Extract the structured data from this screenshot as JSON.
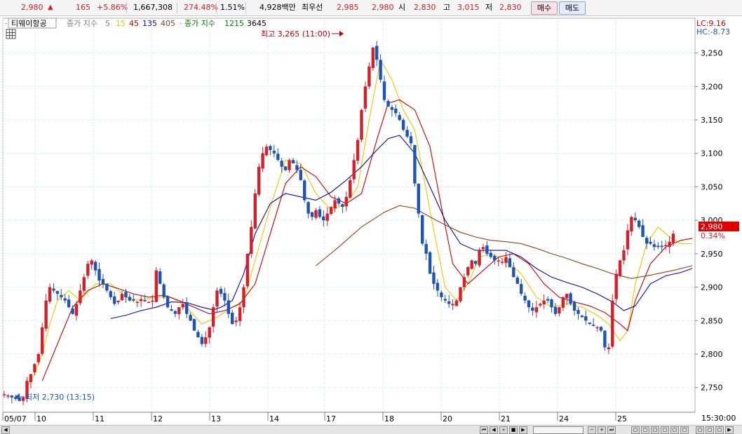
{
  "quote": {
    "price": "2,980",
    "arrow": "▲",
    "change": "165",
    "change_rate": "+5.86%",
    "volume": "1,667,308",
    "volume_ratio": "274.48%",
    "turnover": "1.51%",
    "amount": "4,928백만",
    "best_label": "최우선",
    "best_ask": "2,985",
    "best_bid": "2,980",
    "open_label": "시",
    "open": "2,830",
    "high_label": "고",
    "high": "3,015",
    "low_label": "저",
    "low": "2,830",
    "buy_label": "매수",
    "sell_label": "매도"
  },
  "colors": {
    "up": "#d4202a",
    "down": "#1e54b4",
    "ma5": "#e8c800",
    "ma15": "#c00000",
    "ma45": "#0a0aa0",
    "ma135": "#8b4513",
    "price_tag_bg": "#e00000",
    "grid": "#d9e6f5"
  },
  "legend": {
    "stock_name": "티웨이항공",
    "ma_prefix": "종가 지수",
    "ma_values": [
      "5",
      "15",
      "45",
      "135",
      "405"
    ],
    "ma2_prefix": "종가 지수",
    "ma2_values": [
      "1215",
      "3645"
    ]
  },
  "annotations": {
    "high_text": "최고 3,265 (11:00)",
    "low_text": "최저 2,730 (13:15)"
  },
  "right_panel": {
    "lc": "LC:9.16",
    "hc": "HC:-8.73",
    "current_price": "2,980",
    "current_rate": "0.34%",
    "time": "15:30:00"
  },
  "chart_data": {
    "type": "candlestick",
    "y_axis": {
      "ticks": [
        "3,250",
        "3,200",
        "3,150",
        "3,100",
        "3,050",
        "3,000",
        "2,950",
        "2,900",
        "2,850",
        "2,800",
        "2,750"
      ],
      "ylim": [
        2713,
        3302
      ]
    },
    "x_axis": {
      "labels": [
        "05/07",
        "10",
        "11",
        "12",
        "13",
        "14",
        "17",
        "18",
        "20",
        "21",
        "24",
        "25"
      ]
    },
    "series_price": {
      "name": "close",
      "points": [
        2740,
        2738,
        2735,
        2733,
        2730,
        2735,
        2760,
        2770,
        2785,
        2800,
        2840,
        2880,
        2900,
        2895,
        2890,
        2885,
        2880,
        2870,
        2860,
        2875,
        2895,
        2915,
        2935,
        2940,
        2925,
        2910,
        2905,
        2895,
        2885,
        2875,
        2880,
        2890,
        2885,
        2880,
        2880,
        2878,
        2882,
        2880,
        2878,
        2880,
        2925,
        2905,
        2885,
        2870,
        2865,
        2860,
        2870,
        2875,
        2860,
        2850,
        2835,
        2825,
        2815,
        2825,
        2840,
        2870,
        2895,
        2890,
        2880,
        2860,
        2845,
        2850,
        2870,
        2900,
        2950,
        2990,
        3040,
        3080,
        3100,
        3110,
        3105,
        3100,
        3090,
        3080,
        3075,
        3090,
        3085,
        3075,
        3060,
        3030,
        3010,
        3005,
        3015,
        3005,
        3000,
        3010,
        3020,
        3030,
        3025,
        3020,
        3035,
        3060,
        3090,
        3120,
        3165,
        3200,
        3230,
        3258,
        3240,
        3210,
        3180,
        3170,
        3165,
        3160,
        3150,
        3135,
        3125,
        3115,
        3055,
        3010,
        2965,
        2950,
        2920,
        2905,
        2895,
        2885,
        2880,
        2875,
        2875,
        2880,
        2900,
        2915,
        2930,
        2940,
        2935,
        2955,
        2960,
        2950,
        2945,
        2940,
        2940,
        2938,
        2945,
        2930,
        2915,
        2905,
        2890,
        2880,
        2870,
        2865,
        2870,
        2875,
        2880,
        2880,
        2870,
        2860,
        2870,
        2885,
        2890,
        2875,
        2865,
        2860,
        2855,
        2850,
        2845,
        2842,
        2840,
        2835,
        2810,
        2810,
        2880,
        2920,
        2940,
        2955,
        2985,
        3005,
        3000,
        2990,
        2975,
        2965,
        2965,
        2960,
        2960,
        2960,
        2963,
        2968,
        2980
      ]
    },
    "moving_averages": [
      {
        "name": "5",
        "points": [
          [
            6,
            2750
          ],
          [
            8,
            2770
          ],
          [
            10,
            2800
          ],
          [
            12,
            2845
          ],
          [
            14,
            2880
          ],
          [
            17,
            2895
          ],
          [
            20,
            2880
          ],
          [
            24,
            2905
          ],
          [
            28,
            2905
          ],
          [
            32,
            2885
          ],
          [
            36,
            2880
          ],
          [
            40,
            2885
          ],
          [
            44,
            2885
          ],
          [
            48,
            2870
          ],
          [
            52,
            2845
          ],
          [
            56,
            2855
          ],
          [
            60,
            2870
          ],
          [
            63,
            2880
          ],
          [
            66,
            2940
          ],
          [
            70,
            3020
          ],
          [
            74,
            3090
          ],
          [
            78,
            3085
          ],
          [
            82,
            3040
          ],
          [
            86,
            3015
          ],
          [
            90,
            3025
          ],
          [
            93,
            3050
          ],
          [
            96,
            3150
          ],
          [
            99,
            3240
          ],
          [
            102,
            3210
          ],
          [
            105,
            3165
          ],
          [
            108,
            3135
          ],
          [
            110,
            3075
          ],
          [
            113,
            2985
          ],
          [
            116,
            2900
          ],
          [
            119,
            2880
          ],
          [
            122,
            2905
          ],
          [
            125,
            2945
          ],
          [
            128,
            2950
          ],
          [
            132,
            2940
          ],
          [
            136,
            2920
          ],
          [
            140,
            2885
          ],
          [
            144,
            2870
          ],
          [
            148,
            2875
          ],
          [
            152,
            2870
          ],
          [
            156,
            2858
          ],
          [
            159,
            2845
          ],
          [
            162,
            2820
          ],
          [
            164,
            2835
          ],
          [
            166,
            2905
          ],
          [
            169,
            2965
          ],
          [
            172,
            2990
          ],
          [
            175,
            2975
          ],
          [
            178,
            2965
          ],
          [
            181,
            2965
          ]
        ]
      },
      {
        "name": "15",
        "points": [
          [
            10,
            2760
          ],
          [
            14,
            2815
          ],
          [
            18,
            2870
          ],
          [
            22,
            2895
          ],
          [
            26,
            2905
          ],
          [
            30,
            2898
          ],
          [
            34,
            2890
          ],
          [
            38,
            2885
          ],
          [
            42,
            2888
          ],
          [
            46,
            2880
          ],
          [
            50,
            2870
          ],
          [
            54,
            2860
          ],
          [
            58,
            2865
          ],
          [
            62,
            2875
          ],
          [
            66,
            2905
          ],
          [
            70,
            2980
          ],
          [
            74,
            3055
          ],
          [
            78,
            3080
          ],
          [
            82,
            3065
          ],
          [
            86,
            3035
          ],
          [
            90,
            3025
          ],
          [
            94,
            3040
          ],
          [
            98,
            3120
          ],
          [
            101,
            3175
          ],
          [
            104,
            3180
          ],
          [
            108,
            3165
          ],
          [
            112,
            3110
          ],
          [
            115,
            3020
          ],
          [
            118,
            2935
          ],
          [
            122,
            2905
          ],
          [
            126,
            2925
          ],
          [
            130,
            2945
          ],
          [
            134,
            2950
          ],
          [
            138,
            2935
          ],
          [
            142,
            2905
          ],
          [
            146,
            2885
          ],
          [
            150,
            2878
          ],
          [
            154,
            2872
          ],
          [
            158,
            2862
          ],
          [
            162,
            2845
          ],
          [
            164,
            2835
          ],
          [
            166,
            2880
          ],
          [
            170,
            2935
          ],
          [
            174,
            2960
          ],
          [
            178,
            2970
          ],
          [
            181,
            2973
          ]
        ]
      },
      {
        "name": "45",
        "points": [
          [
            28,
            2853
          ],
          [
            32,
            2858
          ],
          [
            36,
            2865
          ],
          [
            40,
            2870
          ],
          [
            44,
            2878
          ],
          [
            48,
            2877
          ],
          [
            52,
            2870
          ],
          [
            55,
            2866
          ],
          [
            57,
            2870
          ],
          [
            60,
            2880
          ],
          [
            63,
            2920
          ],
          [
            66,
            2980
          ],
          [
            70,
            3025
          ],
          [
            74,
            3040
          ],
          [
            78,
            3035
          ],
          [
            82,
            3030
          ],
          [
            86,
            3042
          ],
          [
            90,
            3060
          ],
          [
            94,
            3080
          ],
          [
            98,
            3105
          ],
          [
            101,
            3122
          ],
          [
            104,
            3127
          ],
          [
            108,
            3100
          ],
          [
            112,
            3050
          ],
          [
            116,
            3000
          ],
          [
            120,
            2965
          ],
          [
            124,
            2955
          ],
          [
            128,
            2955
          ],
          [
            132,
            2955
          ],
          [
            136,
            2945
          ],
          [
            140,
            2928
          ],
          [
            144,
            2915
          ],
          [
            148,
            2907
          ],
          [
            152,
            2900
          ],
          [
            156,
            2890
          ],
          [
            160,
            2878
          ],
          [
            163,
            2865
          ],
          [
            166,
            2872
          ],
          [
            170,
            2905
          ],
          [
            174,
            2917
          ],
          [
            178,
            2922
          ],
          [
            181,
            2928
          ]
        ]
      },
      {
        "name": "135",
        "points": [
          [
            82,
            2932
          ],
          [
            88,
            2960
          ],
          [
            94,
            2990
          ],
          [
            100,
            3012
          ],
          [
            104,
            3022
          ],
          [
            108,
            3018
          ],
          [
            112,
            3005
          ],
          [
            116,
            2993
          ],
          [
            120,
            2982
          ],
          [
            124,
            2975
          ],
          [
            128,
            2970
          ],
          [
            132,
            2968
          ],
          [
            136,
            2965
          ],
          [
            140,
            2958
          ],
          [
            144,
            2950
          ],
          [
            148,
            2943
          ],
          [
            152,
            2935
          ],
          [
            156,
            2928
          ],
          [
            160,
            2920
          ],
          [
            165,
            2913
          ],
          [
            170,
            2918
          ],
          [
            176,
            2925
          ],
          [
            181,
            2932
          ]
        ]
      }
    ]
  }
}
